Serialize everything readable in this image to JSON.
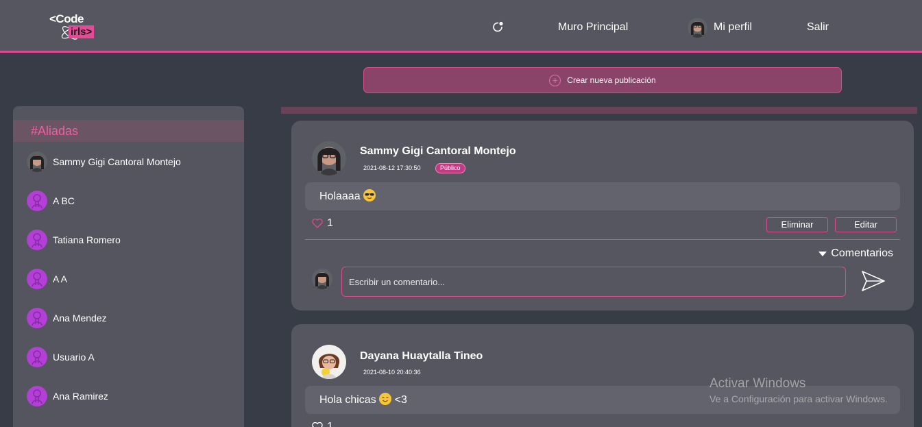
{
  "header": {
    "logo_line1": "<Code",
    "logo_line2": "irls>",
    "nav_refresh_icon": "refresh-icon",
    "nav_home": "Muro Principal",
    "nav_profile": "Mi perfil",
    "nav_logout": "Salir"
  },
  "create_post": {
    "label": "Crear nueva publicación",
    "icon": "plus-circle-icon"
  },
  "sidebar": {
    "title": "#Aliadas",
    "allies": [
      {
        "name": "Sammy Gigi Cantoral Montejo",
        "avatar": "photo"
      },
      {
        "name": "A BC",
        "avatar": "default"
      },
      {
        "name": "Tatiana Romero",
        "avatar": "default"
      },
      {
        "name": "A A",
        "avatar": "default"
      },
      {
        "name": "Ana Mendez",
        "avatar": "default"
      },
      {
        "name": "Usuario A",
        "avatar": "default"
      },
      {
        "name": "Ana Ramirez",
        "avatar": "default"
      }
    ]
  },
  "posts": [
    {
      "author": "Sammy Gigi Cantoral Montejo",
      "date": "2021-08-12 17:30:50",
      "privacy": "Público",
      "text": "Holaaaa",
      "emoji": "sunglasses-emoji",
      "likes": "1",
      "delete_label": "Eliminar",
      "edit_label": "Editar",
      "comments_label": "Comentarios",
      "comment_placeholder": "Escribir un comentario..."
    },
    {
      "author": "Dayana Huaytalla Tineo",
      "date": "2021-08-10 20:40:36",
      "text": "Hola chicas",
      "text_suffix": "<3",
      "emoji": "smiling-emoji",
      "likes": "1"
    }
  ],
  "watermark": {
    "line1": "Activar Windows",
    "line2": "Ve a Configuración para activar Windows."
  },
  "colors": {
    "accent": "#e0488f",
    "header_bg": "#55565f",
    "page_bg": "#383c46",
    "card_bg": "#55565f",
    "default_avatar": "#b33fd6"
  }
}
